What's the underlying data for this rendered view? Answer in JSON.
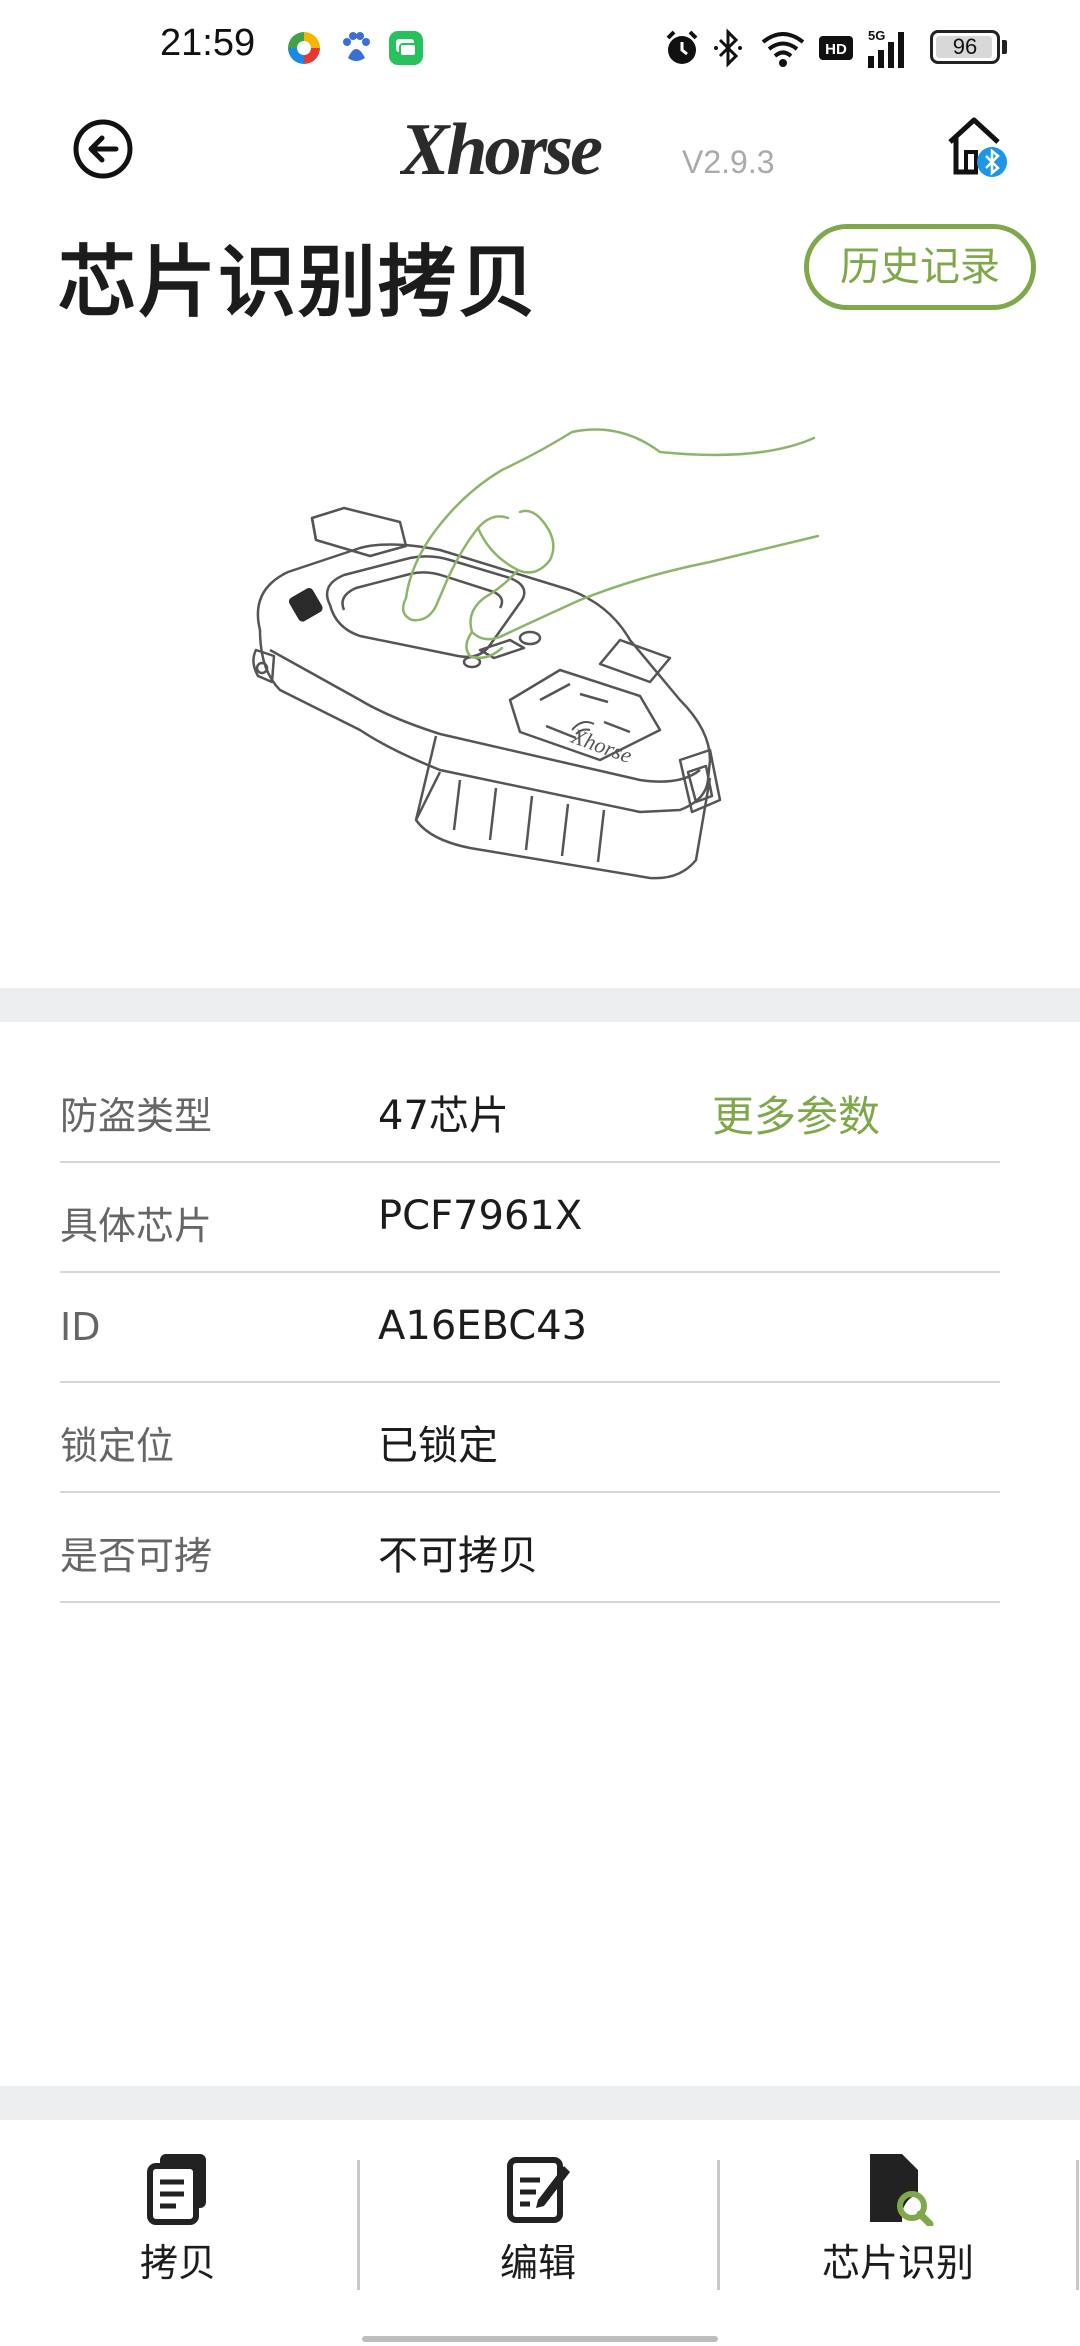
{
  "status_bar": {
    "time": "21:59",
    "battery": "96",
    "left_icons": [
      "app-colorful-icon",
      "baidu-paw-icon",
      "chat-bubble-icon"
    ],
    "right_icons": [
      "alarm-icon",
      "bluetooth-icon",
      "wifi-icon",
      "hd-icon",
      "5g-signal-icon",
      "battery-icon"
    ]
  },
  "header": {
    "logo": "Xhorse",
    "version": "V2.9.3",
    "back_icon": "back-arrow-icon",
    "home_icon": "home-bluetooth-icon"
  },
  "page": {
    "title": "芯片识别拷贝",
    "history_button": "历史记录"
  },
  "info": {
    "more_link": "更多参数",
    "rows": [
      {
        "label": "防盗类型",
        "value": "47芯片"
      },
      {
        "label": "具体芯片",
        "value": "PCF7961X"
      },
      {
        "label": "ID",
        "value": "A16EBC43"
      },
      {
        "label": "锁定位",
        "value": "已锁定"
      },
      {
        "label": "是否可拷",
        "value": "不可拷贝"
      }
    ]
  },
  "bottom_nav": {
    "items": [
      {
        "label": "拷贝",
        "icon": "copy-icon"
      },
      {
        "label": "编辑",
        "icon": "edit-icon"
      },
      {
        "label": "芯片识别",
        "icon": "chip-search-icon"
      }
    ]
  },
  "colors": {
    "accent": "#7fa84a",
    "band": "#eceef0",
    "text": "#1c1c1c",
    "label": "#666666"
  }
}
